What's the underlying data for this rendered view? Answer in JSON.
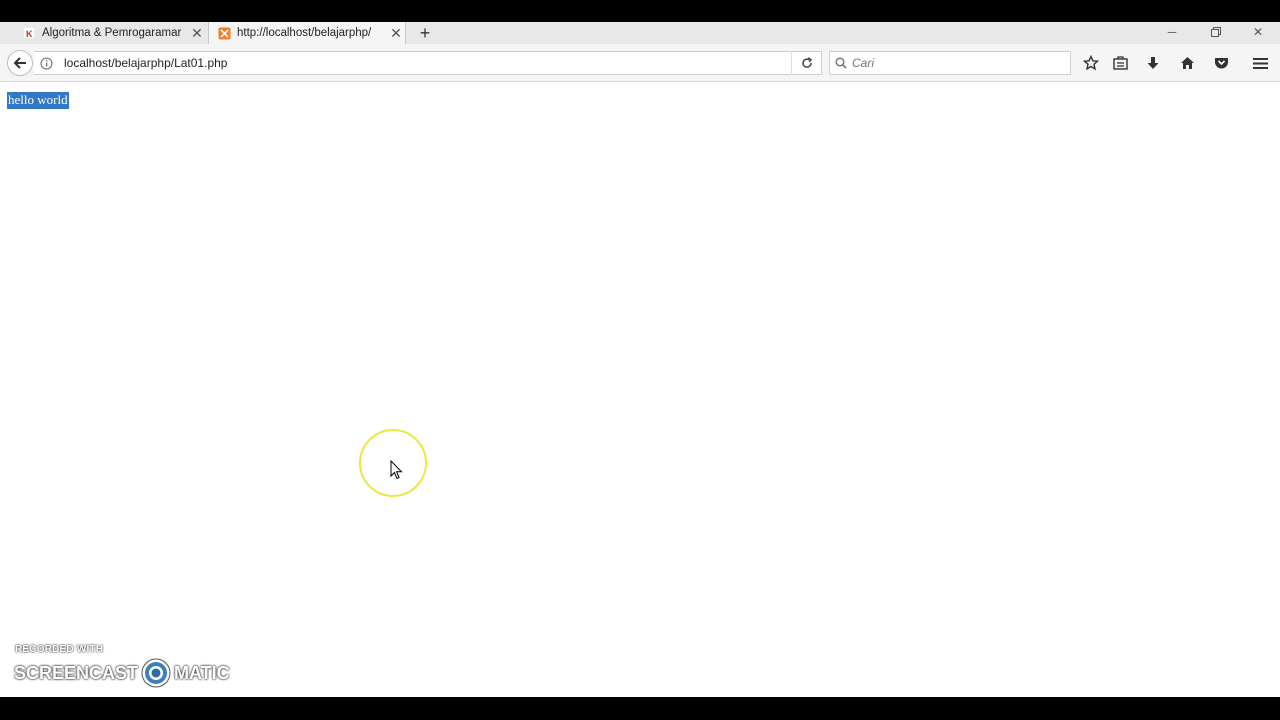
{
  "browser": {
    "tabs": [
      {
        "title": "Algoritma & Pemrogaramar",
        "active": false,
        "favicon": "k-site-favicon"
      },
      {
        "title": "http://localhost/belajarphp/",
        "active": true,
        "favicon": "xampp-favicon"
      }
    ],
    "new_tab_icon": "plus-icon",
    "window_controls": [
      "minimize-icon",
      "restore-icon",
      "close-icon"
    ],
    "address": {
      "url": "localhost/belajarphp/Lat01.php"
    },
    "search": {
      "placeholder": "Cari"
    },
    "toolbar_icons": [
      "star-icon",
      "reading-list-icon",
      "download-icon",
      "home-icon",
      "pocket-icon",
      "menu-icon"
    ]
  },
  "page": {
    "text": "hello world",
    "selection_color": "#3378c7"
  },
  "watermark": {
    "line1": "RECORDED WITH",
    "brand_left": "SCREENCAST",
    "brand_right": "MATIC"
  },
  "colors": {
    "cursor_ring": "#ebe640"
  }
}
